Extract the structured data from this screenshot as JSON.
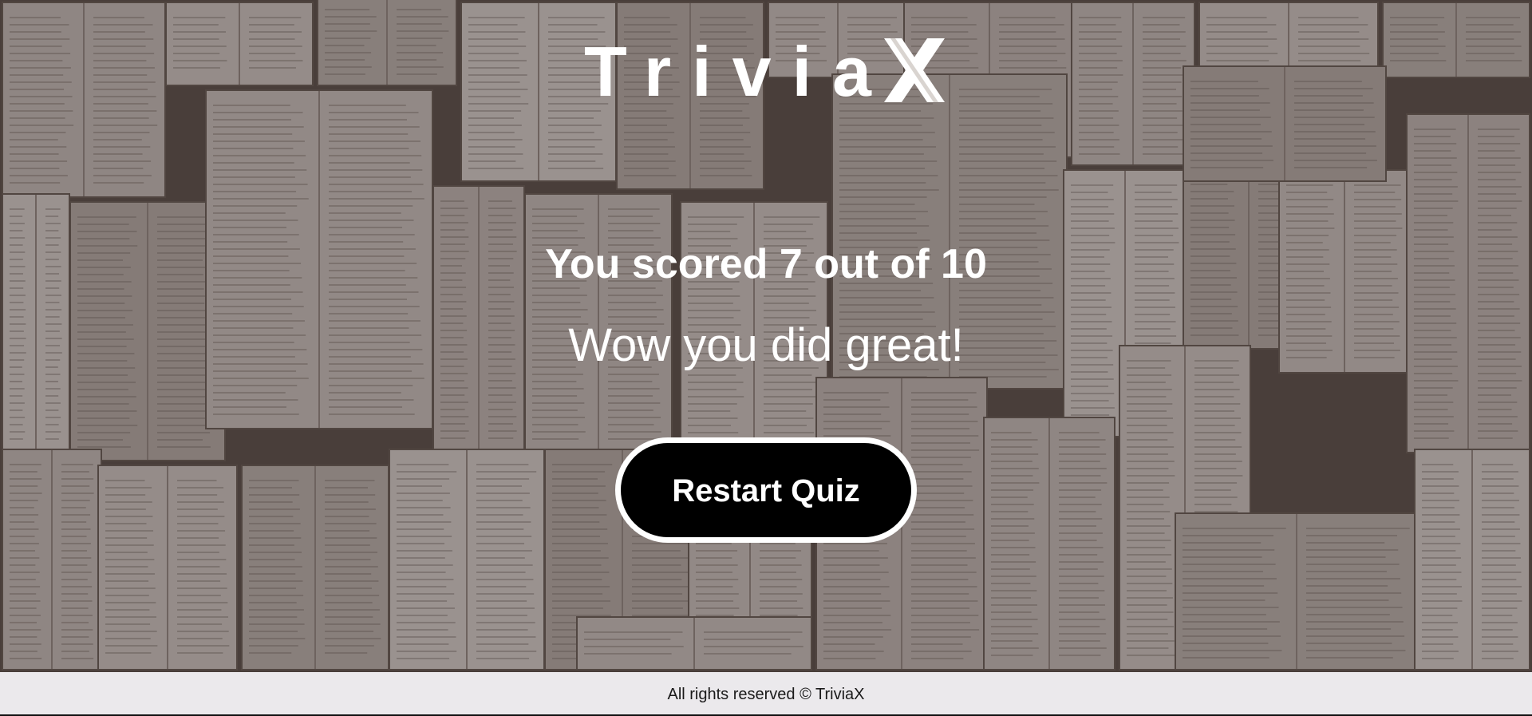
{
  "app": {
    "logo_text": "Trivia",
    "logo_mark": "X"
  },
  "result": {
    "score_text": "You scored 7 out of 10",
    "message": "Wow you did great!"
  },
  "actions": {
    "restart_label": "Restart Quiz"
  },
  "footer": {
    "text": "All rights reserved © TriviaX"
  },
  "colors": {
    "text": "#ffffff",
    "button_bg": "#000000",
    "button_border": "#ffffff",
    "footer_bg": "#ebe9ec"
  },
  "background": {
    "image": "open-books-wall"
  }
}
